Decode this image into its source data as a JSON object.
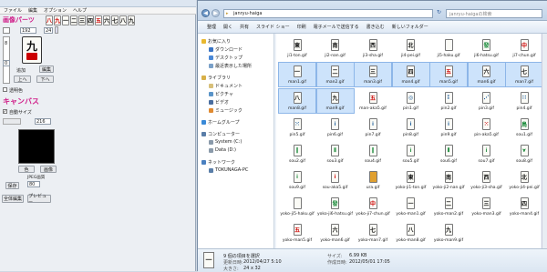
{
  "left_window": {
    "menu": [
      "ファイル",
      "編集",
      "オプション",
      "ヘルプ"
    ],
    "section_title": "画像パーツ",
    "tile_glyphs": [
      "八",
      "九",
      "一",
      "二",
      "三",
      "四",
      "五",
      "六",
      "七",
      "八",
      "九"
    ],
    "tile_colors": [
      "#c00",
      "#c00",
      "#111",
      "#111",
      "#111",
      "#111",
      "#c00",
      "#111",
      "#111",
      "#111",
      "#111"
    ],
    "field_a": "192",
    "field_b": "24",
    "big_tile_glyph": "九",
    "scroll_value": "8",
    "counter_value": "0",
    "btn_add": "追加",
    "btn_edit": "編集",
    "btn_up": "上へ",
    "btn_down": "下へ",
    "transparent_label": "透明色",
    "canvas_title": "キャンバス",
    "auto_size_label": "自動サイズ",
    "width_value": "216",
    "color_button": "色",
    "image_button": "画像",
    "jpeg_label": "JPEG画質",
    "jpeg_value": "80",
    "save_button": "保存",
    "clear_all": "全体編集",
    "preview": "プレビュー"
  },
  "explorer": {
    "address": "janryu-haiga",
    "search_placeholder": "janryu-haigaの検索",
    "toolbar": [
      "整理",
      "開く",
      "共有",
      "スライド ショー",
      "印刷",
      "電子メールで送信する",
      "書き込む",
      "新しいフォルダー"
    ],
    "nav": [
      {
        "label": "お気に入り",
        "color": "#e8b830",
        "indent": 0
      },
      {
        "label": "ダウンロード",
        "color": "#3a74c4",
        "indent": 1
      },
      {
        "label": "デスクトップ",
        "color": "#4a88d6",
        "indent": 1
      },
      {
        "label": "最近表示した場所",
        "color": "#7aa0c8",
        "indent": 1
      },
      {
        "label": "",
        "color": "",
        "indent": 0
      },
      {
        "label": "ライブラリ",
        "color": "#d8b048",
        "indent": 0
      },
      {
        "label": "ドキュメント",
        "color": "#d8c07a",
        "indent": 1
      },
      {
        "label": "ピクチャ",
        "color": "#5a94c8",
        "indent": 1
      },
      {
        "label": "ビデオ",
        "color": "#4a6ea0",
        "indent": 1
      },
      {
        "label": "ミュージック",
        "color": "#e08a30",
        "indent": 1
      },
      {
        "label": "",
        "color": "",
        "indent": 0
      },
      {
        "label": "ホームグループ",
        "color": "#3a8ad8",
        "indent": 0
      },
      {
        "label": "",
        "color": "",
        "indent": 0
      },
      {
        "label": "コンピューター",
        "color": "#5a7ea8",
        "indent": 0
      },
      {
        "label": "System (C:)",
        "color": "#8a9aaa",
        "indent": 1
      },
      {
        "label": "Data (D:)",
        "color": "#8a9aaa",
        "indent": 1
      },
      {
        "label": "",
        "color": "",
        "indent": 0
      },
      {
        "label": "ネットワーク",
        "color": "#4a80c0",
        "indent": 0
      },
      {
        "label": "TOKUNAGA-PC",
        "color": "#5a7ea8",
        "indent": 1
      }
    ],
    "files": [
      {
        "name": "ji1-ton.gif",
        "g": "東",
        "c": "#111",
        "sel": false
      },
      {
        "name": "ji2-nan.gif",
        "g": "南",
        "c": "#111",
        "sel": false
      },
      {
        "name": "ji3-sha.gif",
        "g": "西",
        "c": "#111",
        "sel": false
      },
      {
        "name": "ji4-pei.gif",
        "g": "北",
        "c": "#111",
        "sel": false
      },
      {
        "name": "ji5-haku.gif",
        "g": "",
        "c": "#111",
        "sel": false
      },
      {
        "name": "ji6-hatsu.gif",
        "g": "發",
        "c": "#1a8a3a",
        "sel": false
      },
      {
        "name": "ji7-chun.gif",
        "g": "中",
        "c": "#c00",
        "sel": false
      },
      {
        "name": "man1.gif",
        "g": "一",
        "c": "#111",
        "sel": true
      },
      {
        "name": "man2.gif",
        "g": "二",
        "c": "#111",
        "sel": true
      },
      {
        "name": "man3.gif",
        "g": "三",
        "c": "#111",
        "sel": true
      },
      {
        "name": "man4.gif",
        "g": "四",
        "c": "#111",
        "sel": true
      },
      {
        "name": "man5.gif",
        "g": "五",
        "c": "#c00",
        "sel": true
      },
      {
        "name": "man6.gif",
        "g": "六",
        "c": "#111",
        "sel": true
      },
      {
        "name": "man7.gif",
        "g": "七",
        "c": "#111",
        "sel": true
      },
      {
        "name": "man8.gif",
        "g": "八",
        "c": "#111",
        "sel": true
      },
      {
        "name": "man9.gif",
        "g": "九",
        "c": "#111",
        "sel": true
      },
      {
        "name": "man-aka5.gif",
        "g": "五",
        "c": "#c00",
        "sel": false
      },
      {
        "name": "pin1.gif",
        "g": "◎",
        "c": "#1a5a9a",
        "sel": false
      },
      {
        "name": "pin2.gif",
        "g": "⁑",
        "c": "#1a5a9a",
        "sel": false
      },
      {
        "name": "pin3.gif",
        "g": "⋰",
        "c": "#1a5a9a",
        "sel": false
      },
      {
        "name": "pin4.gif",
        "g": "∷",
        "c": "#1a5a9a",
        "sel": false
      },
      {
        "name": "pin5.gif",
        "g": "⁙",
        "c": "#1a5a9a",
        "sel": false
      },
      {
        "name": "pin6.gif",
        "g": "⁞",
        "c": "#1a5a9a",
        "sel": false
      },
      {
        "name": "pin7.gif",
        "g": "⁞",
        "c": "#1a5a9a",
        "sel": false
      },
      {
        "name": "pin8.gif",
        "g": "⁞",
        "c": "#1a5a9a",
        "sel": false
      },
      {
        "name": "pin9.gif",
        "g": "⁞",
        "c": "#1a5a9a",
        "sel": false
      },
      {
        "name": "pin-aka5.gif",
        "g": "⁙",
        "c": "#c00",
        "sel": false
      },
      {
        "name": "sou1.gif",
        "g": "鳥",
        "c": "#1a8a3a",
        "sel": false
      },
      {
        "name": "sou2.gif",
        "g": "‖",
        "c": "#1a8a3a",
        "sel": false
      },
      {
        "name": "sou3.gif",
        "g": "⫴",
        "c": "#1a8a3a",
        "sel": false
      },
      {
        "name": "sou4.gif",
        "g": "‖",
        "c": "#1a8a3a",
        "sel": false
      },
      {
        "name": "sou5.gif",
        "g": "⁞",
        "c": "#1a8a3a",
        "sel": false
      },
      {
        "name": "sou6.gif",
        "g": "⫴",
        "c": "#1a8a3a",
        "sel": false
      },
      {
        "name": "sou7.gif",
        "g": "⁞",
        "c": "#1a8a3a",
        "sel": false
      },
      {
        "name": "sou8.gif",
        "g": "⩔",
        "c": "#1a8a3a",
        "sel": false
      },
      {
        "name": "sou9.gif",
        "g": "⁞",
        "c": "#1a8a3a",
        "sel": false
      },
      {
        "name": "sou-aka5.gif",
        "g": "⁞",
        "c": "#c00",
        "sel": false
      },
      {
        "name": "ura.gif",
        "g": "",
        "c": "#e0a030",
        "sel": false
      },
      {
        "name": "yoko-ji1-ton.gif",
        "g": "東",
        "c": "#111",
        "sel": false
      },
      {
        "name": "yoko-ji2-nan.gif",
        "g": "南",
        "c": "#111",
        "sel": false
      },
      {
        "name": "yoko-ji3-sha.gif",
        "g": "西",
        "c": "#111",
        "sel": false
      },
      {
        "name": "yoko-ji4-pei.gif",
        "g": "北",
        "c": "#111",
        "sel": false
      },
      {
        "name": "yoko-ji5-haku.gif",
        "g": "",
        "c": "#111",
        "sel": false
      },
      {
        "name": "yoko-ji6-hatsu.gif",
        "g": "發",
        "c": "#1a8a3a",
        "sel": false
      },
      {
        "name": "yoko-ji7-chun.gif",
        "g": "中",
        "c": "#c00",
        "sel": false
      },
      {
        "name": "yoko-man1.gif",
        "g": "一",
        "c": "#111",
        "sel": false
      },
      {
        "name": "yoko-man2.gif",
        "g": "二",
        "c": "#111",
        "sel": false
      },
      {
        "name": "yoko-man3.gif",
        "g": "三",
        "c": "#111",
        "sel": false
      },
      {
        "name": "yoko-man4.gif",
        "g": "四",
        "c": "#111",
        "sel": false
      },
      {
        "name": "yoko-man5.gif",
        "g": "五",
        "c": "#c00",
        "sel": false
      },
      {
        "name": "yoko-man6.gif",
        "g": "六",
        "c": "#111",
        "sel": false
      },
      {
        "name": "yoko-man7.gif",
        "g": "七",
        "c": "#111",
        "sel": false
      },
      {
        "name": "yoko-man8.gif",
        "g": "八",
        "c": "#111",
        "sel": false
      },
      {
        "name": "yoko-man9.gif",
        "g": "九",
        "c": "#111",
        "sel": false
      }
    ],
    "details": {
      "selected": "9 個の項目を選択",
      "updated_label": "更新日時:",
      "updated": "2012/04/27 5:10",
      "size_label": "サイズ:",
      "size": "6.99 KB",
      "dim_label": "大きさ:",
      "dim": "24 x 32",
      "created_label": "作成日時:",
      "created": "2012/05/01 17:05"
    }
  }
}
